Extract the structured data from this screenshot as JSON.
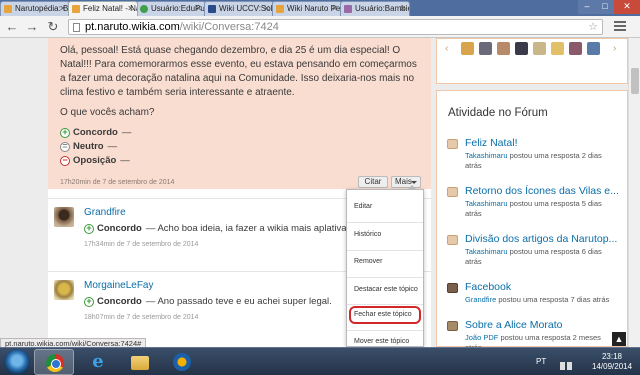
{
  "tabs": [
    {
      "label": "Narutopédia: Be",
      "color": "#e8a43c"
    },
    {
      "label": "Feliz Natal! - Na",
      "color": "#e8a43c",
      "active": true
    },
    {
      "label": "Usuário:EduPuff",
      "color": "#3ea04a"
    },
    {
      "label": "Wiki UCCV:Sobre",
      "color": "#2b4a8a"
    },
    {
      "label": "Wiki Naruto Ped",
      "color": "#e8a43c"
    },
    {
      "label": "Usuário:Bambiet",
      "color": "#9a6aa8"
    }
  ],
  "window_controls": {
    "minimize": "–",
    "maximize": "□",
    "close": "✕"
  },
  "address": {
    "domain": "pt.naruto.wikia.com",
    "path": "/wiki/Conversa:7424"
  },
  "post": {
    "paragraph1": "Olá, pessoal! Está quase chegando dezembro, e dia 25 é um dia especial! O Natal!!! Para comemorarmos esse evento, eu estava pensando em começarmos a fazer uma decoração natalina aqui na Comunidade. Isso deixaria-nos mais no clima festivo e também seria interessante e atraente.",
    "paragraph2": "O que vocês acham?",
    "poll": [
      {
        "label": "Concordo",
        "suffix": "—",
        "icon": "plus"
      },
      {
        "label": "Neutro",
        "suffix": "—",
        "icon": "equals"
      },
      {
        "label": "Oposição",
        "suffix": "—",
        "icon": "minus"
      }
    ],
    "meta": "17h20min de 7 de setembro de 2014",
    "quote_button": "Citar",
    "more_button": "Mais"
  },
  "replies": [
    {
      "user": "Grandfire",
      "vote": "Concordo",
      "text": "— Acho boa ideia, ia fazer a wikia mais aplativa.",
      "meta": "17h34min de 7 de setembro de 2014"
    },
    {
      "user": "MorgaineLeFay",
      "vote": "Concordo",
      "text": "— Ano passado teve e eu achei super legal.",
      "meta": "18h07min de 7 de setembro de 2014"
    }
  ],
  "dropdown": {
    "items": [
      "Editar",
      "Histórico",
      "Remover",
      "Destacar este tópico",
      "Fechar este tópico",
      "Mover este tópico"
    ],
    "highlight_color": "#d4272b"
  },
  "sidebar": {
    "title": "Atividade no Fórum",
    "activities": [
      {
        "title": "Feliz Natal!",
        "user": "Takashimaru",
        "desc": " postou uma resposta 2 dias atrás"
      },
      {
        "title": "Retorno dos Ícones das Vilas e...",
        "user": "Takashimaru",
        "desc": " postou uma resposta 5 dias atrás"
      },
      {
        "title": "Divisão dos artigos da Narutop...",
        "user": "Takashimaru",
        "desc": " postou uma resposta 6 dias atrás"
      },
      {
        "title": "Facebook",
        "user": "Grandfire",
        "desc": " postou uma resposta 7 dias atrás"
      },
      {
        "title": "Sobre a Alice Morato",
        "user": "João PDF",
        "desc": " postou uma resposta 2 meses atrás"
      }
    ]
  },
  "status_url": "pt.naruto.wikia.com/wiki/Conversa:7424#",
  "taskbar": {
    "language": "PT",
    "time": "23:18",
    "date": "14/09/2014"
  },
  "colors": {
    "link": "#0a6ea8",
    "post_bg": "#f9ddd0",
    "sidebar_border": "#f0c6a8"
  }
}
